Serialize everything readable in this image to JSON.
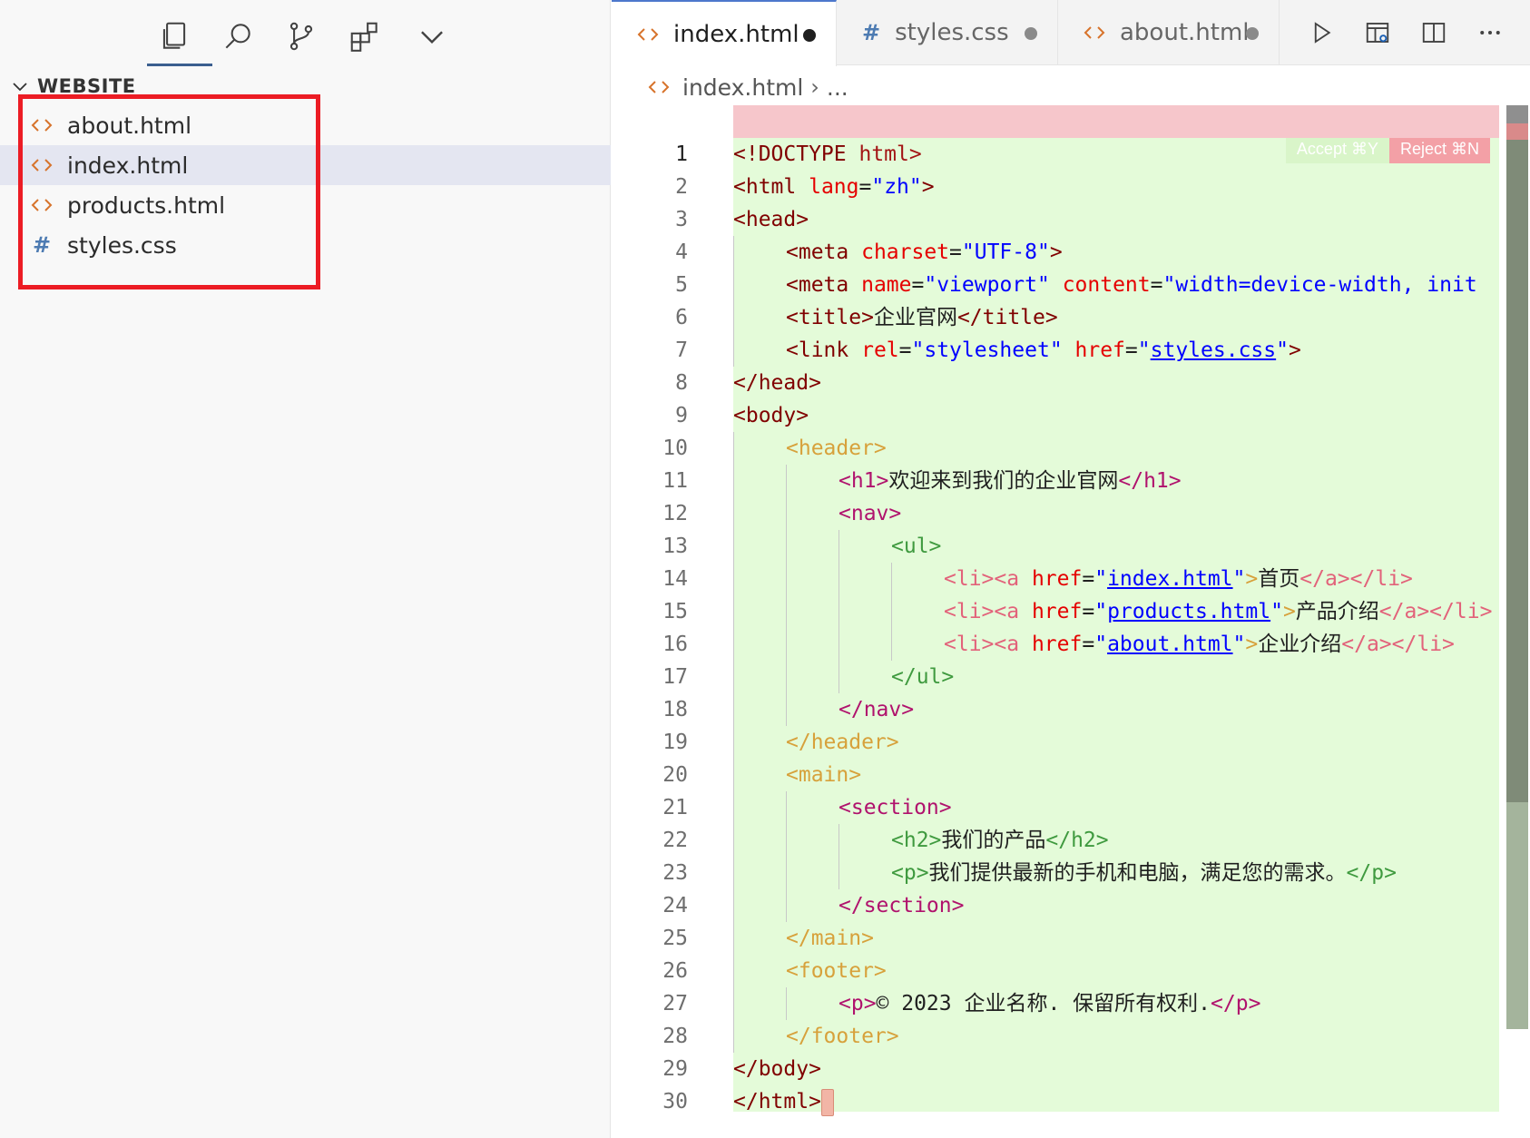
{
  "sidebar": {
    "section_title": "WEBSITE",
    "files": [
      {
        "name": "about.html",
        "icon": "html-icon",
        "selected": false
      },
      {
        "name": "index.html",
        "icon": "html-icon",
        "selected": true
      },
      {
        "name": "products.html",
        "icon": "html-icon",
        "selected": false
      },
      {
        "name": "styles.css",
        "icon": "css-hash-icon",
        "selected": false
      }
    ]
  },
  "tabs": [
    {
      "label": "index.html",
      "icon": "html-icon",
      "active": true,
      "dirty": true
    },
    {
      "label": "styles.css",
      "icon": "css-hash-icon",
      "active": false,
      "dirty": true
    },
    {
      "label": "about.html",
      "icon": "html-icon",
      "active": false,
      "dirty": true
    }
  ],
  "breadcrumb": {
    "file": "index.html",
    "more": "..."
  },
  "diff_actions": {
    "accept": "Accept ⌘Y",
    "reject": "Reject ⌘N"
  },
  "code": {
    "line_numbers": [
      "1",
      "2",
      "3",
      "4",
      "5",
      "6",
      "7",
      "8",
      "9",
      "10",
      "11",
      "12",
      "13",
      "14",
      "15",
      "16",
      "17",
      "18",
      "19",
      "20",
      "21",
      "22",
      "23",
      "24",
      "25",
      "26",
      "27",
      "28",
      "29",
      "30"
    ],
    "l1": {
      "a": "<!DOCTYPE",
      "b": " html>"
    },
    "l2": {
      "a": "<html",
      "b": " lang",
      "c": "=",
      "d": "\"zh\"",
      "e": ">"
    },
    "l3": "<head>",
    "l4": {
      "a": "<meta",
      "b": " charset",
      "c": "=",
      "d": "\"UTF-8\"",
      "e": ">"
    },
    "l5": {
      "a": "<meta",
      "b": " name",
      "c": "=",
      "d": "\"viewport\"",
      "e": " content",
      "f": "=",
      "g": "\"width=device-width, init"
    },
    "l6": {
      "a": "<title>",
      "b": "企业官网",
      "c": "</title>"
    },
    "l7": {
      "a": "<link",
      "b": " rel",
      "c": "=",
      "d": "\"stylesheet\"",
      "e": " href",
      "f": "=",
      "g": "\"",
      "h": "styles.css",
      "i": "\"",
      "j": ">"
    },
    "l8": "</head>",
    "l9": "<body>",
    "l10": "<header>",
    "l11": {
      "a": "<h1>",
      "b": "欢迎来到我们的企业官网",
      "c": "</h1>"
    },
    "l12": "<nav>",
    "l13": "<ul>",
    "l14": {
      "a": "<li><a",
      "b": " href",
      "c": "=",
      "d": "\"",
      "e": "index.html",
      "f": "\"",
      "g": ">",
      "h": "首页",
      "i": "</a></li>"
    },
    "l15": {
      "a": "<li><a",
      "b": " href",
      "c": "=",
      "d": "\"",
      "e": "products.html",
      "f": "\"",
      "g": ">",
      "h": "产品介绍",
      "i": "</a></li>"
    },
    "l16": {
      "a": "<li><a",
      "b": " href",
      "c": "=",
      "d": "\"",
      "e": "about.html",
      "f": "\"",
      "g": ">",
      "h": "企业介绍",
      "i": "</a></li>"
    },
    "l17": "</ul>",
    "l18": "</nav>",
    "l19": "</header>",
    "l20": "<main>",
    "l21": "<section>",
    "l22": {
      "a": "<h2>",
      "b": "我们的产品",
      "c": "</h2>"
    },
    "l23": {
      "a": "<p>",
      "b": "我们提供最新的手机和电脑，满足您的需求。",
      "c": "</p>"
    },
    "l24": "</section>",
    "l25": "</main>",
    "l26": "<footer>",
    "l27": {
      "a": "<p>",
      "b": "© 2023 企业名称. 保留所有权利.",
      "c": "</p>"
    },
    "l28": "</footer>",
    "l29": "</body>",
    "l30": "</html>"
  }
}
